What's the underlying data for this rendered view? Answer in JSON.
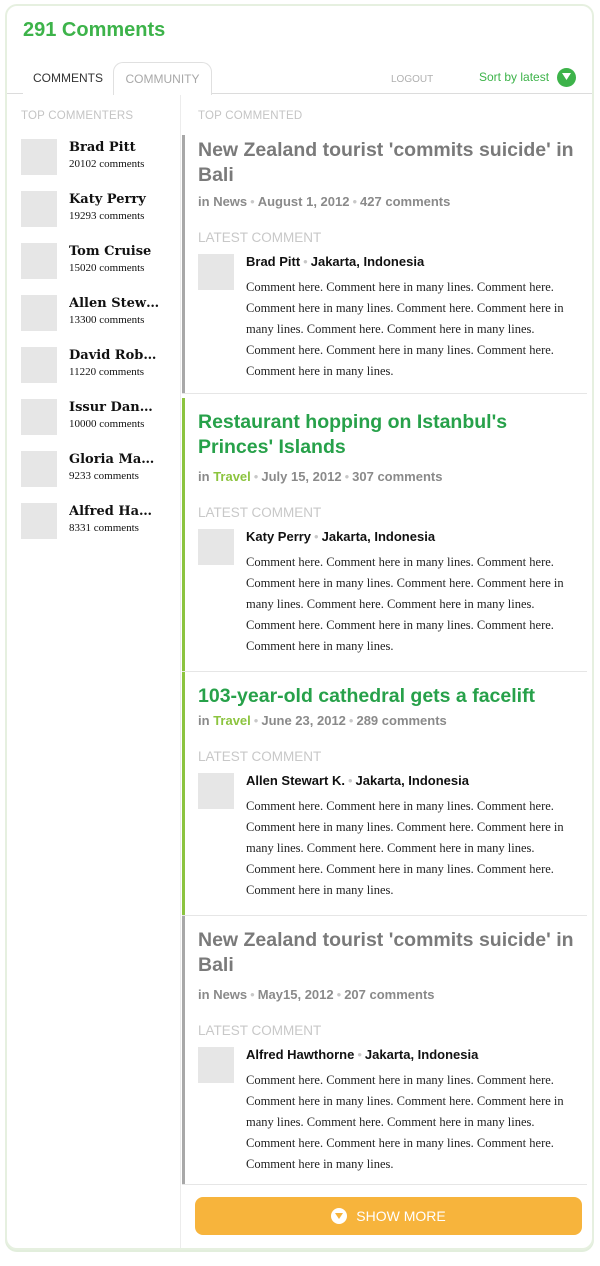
{
  "header": {
    "title": "291 Comments",
    "tabs": [
      {
        "label": "COMMENTS"
      },
      {
        "label": "COMMUNITY"
      }
    ],
    "logout_label": "LOGOUT",
    "sort_label": "Sort by latest",
    "sort_icon": "chevron-down-icon",
    "accent_color": "#3db34a"
  },
  "sidebar": {
    "label": "TOP COMMENTERS",
    "commenters": [
      {
        "name": "Brad Pitt",
        "count": "20102 comments"
      },
      {
        "name": "Katy Perry",
        "count": "19293 comments"
      },
      {
        "name": "Tom Cruise",
        "count": "15020 comments"
      },
      {
        "name": "Allen Stew…",
        "count": "13300 comments"
      },
      {
        "name": "David Rob…",
        "count": "11220 comments"
      },
      {
        "name": "Issur Dan…",
        "count": "10000 comments"
      },
      {
        "name": "Gloria Ma…",
        "count": "9233 comments"
      },
      {
        "name": "Alfred Ha…",
        "count": "8331 comments"
      }
    ]
  },
  "main": {
    "label": "TOP COMMENTED",
    "latest_comment_label": "LATEST COMMENT",
    "articles": [
      {
        "title": "New Zealand tourist 'commits suicide' in Bali",
        "prefix": "in",
        "category": "News",
        "date": "August 1, 2012",
        "comments": "427 comments",
        "commenter": "Brad Pitt",
        "location": "Jakarta, Indonesia",
        "comment": "Comment here. Comment here in many lines. Comment here. Comment here in many lines. Comment here. Comment here in many lines. Comment here. Comment here in many lines. Comment here. Comment here in many lines. Comment here. Comment here in many lines."
      },
      {
        "title": "Restaurant hopping on Istanbul's Princes' Islands",
        "prefix": "in",
        "category": "Travel",
        "date": "July 15, 2012",
        "comments": "307 comments",
        "commenter": "Katy Perry",
        "location": "Jakarta, Indonesia",
        "comment": "Comment here. Comment here in many lines. Comment here. Comment here in many lines. Comment here. Comment here in many lines. Comment here. Comment here in many lines. Comment here. Comment here in many lines. Comment here. Comment here in many lines."
      },
      {
        "title": "103-year-old cathedral gets a facelift",
        "prefix": "in",
        "category": "Travel",
        "date": "June 23, 2012",
        "comments": "289 comments",
        "commenter": "Allen Stewart K.",
        "location": "Jakarta, Indonesia",
        "comment": "Comment here. Comment here in many lines. Comment here. Comment here in many lines. Comment here. Comment here in many lines. Comment here. Comment here in many lines. Comment here. Comment here in many lines. Comment here. Comment here in many lines."
      },
      {
        "title": "New Zealand tourist 'commits suicide' in Bali",
        "prefix": "in",
        "category": "News",
        "date": "May15, 2012",
        "comments": "207 comments",
        "commenter": "Alfred Hawthorne",
        "location": "Jakarta, Indonesia",
        "comment": "Comment here. Comment here in many lines. Comment here. Comment here in many lines. Comment here. Comment here in many lines. Comment here. Comment here in many lines. Comment here. Comment here in many lines. Comment here. Comment here in many lines."
      }
    ],
    "show_more_label": "SHOW MORE",
    "show_more_icon": "chevron-down-icon",
    "show_more_color": "#f7b43c"
  }
}
